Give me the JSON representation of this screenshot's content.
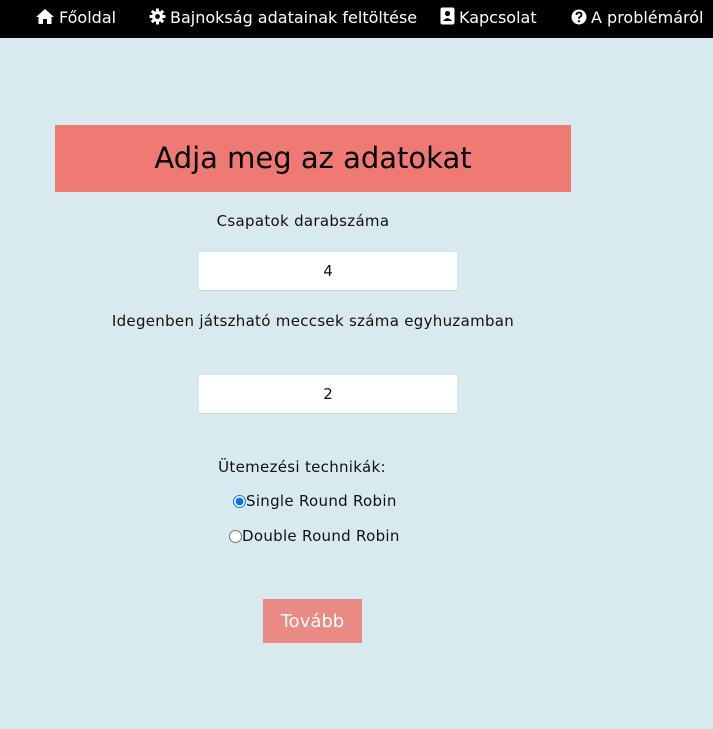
{
  "nav": {
    "home_label": "Főoldal",
    "upload_label": "Bajnokság adatainak feltöltése",
    "contact_label": "Kapcsolat",
    "about_label": "A problémáról",
    "icons": [
      "home-icon",
      "gear-icon",
      "contact-card-icon",
      "question-icon"
    ]
  },
  "form": {
    "title": "Adja meg az adatokat",
    "teams_label": "Csapatok darabszáma",
    "teams_value": "4",
    "away_label": "Idegenben játszható meccsek száma egyhuzamban",
    "away_value": "2",
    "technique_label": "Ütemezési technikák:",
    "options": [
      {
        "label": "Single Round Robin",
        "selected": true
      },
      {
        "label": "Double Round Robin",
        "selected": false
      }
    ],
    "submit_label": "Tovább"
  },
  "colors": {
    "background": "#d9e9f0",
    "navbar": "#000000",
    "header": "#ee7a73",
    "button": "#ea8a84"
  }
}
